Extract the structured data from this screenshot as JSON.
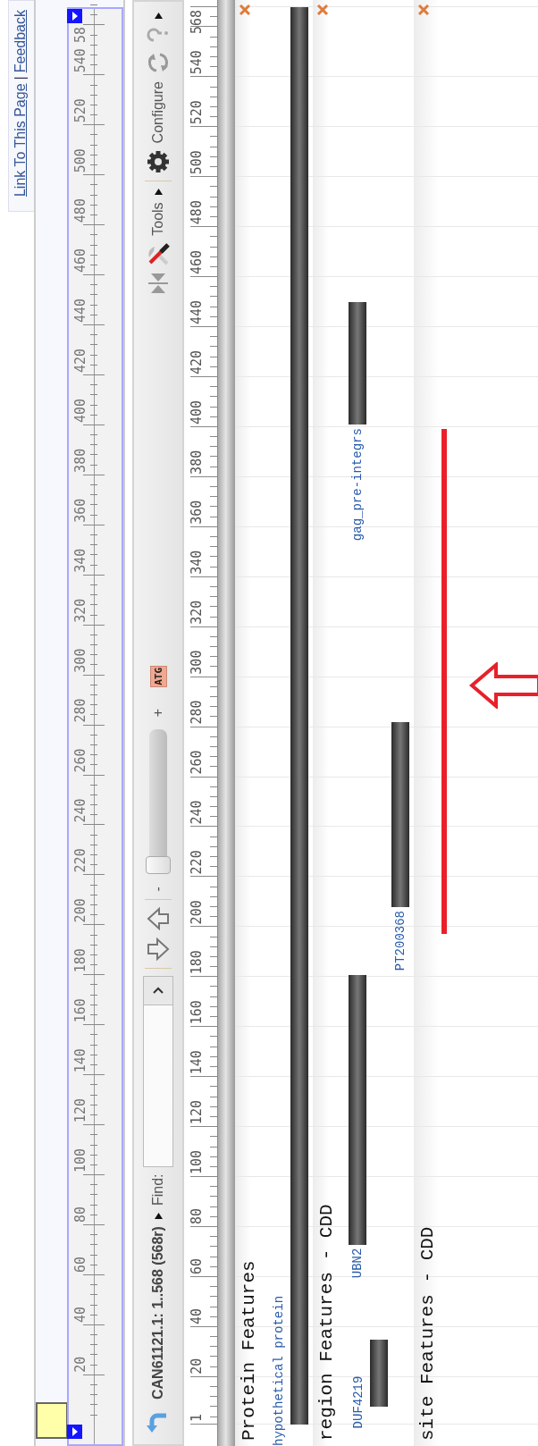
{
  "header": {
    "links": [
      {
        "label": "Link To This Page"
      },
      {
        "label": "Feedback"
      }
    ],
    "separator": "|"
  },
  "overview": {
    "ticks": [
      "20",
      "40",
      "60",
      "80",
      "100",
      "120",
      "140",
      "160",
      "180",
      "200",
      "220",
      "240",
      "260",
      "280",
      "300",
      "320",
      "340",
      "360",
      "380",
      "400",
      "420",
      "440",
      "460",
      "480",
      "500",
      "520",
      "540",
      "58"
    ]
  },
  "toolbar": {
    "sequence": "CAN61121.1: 1..568 (568r)",
    "find_label": "Find:",
    "zoom_out": "-",
    "zoom": {
      "level": 0
    },
    "zoom_in": "+",
    "sequence_button": "ATG",
    "tools": "Tools",
    "configure": "Configure"
  },
  "ruler": {
    "ticks": [
      "1",
      "20",
      "40",
      "60",
      "80",
      "100",
      "120",
      "140",
      "160",
      "180",
      "200",
      "220",
      "240",
      "260",
      "280",
      "300",
      "320",
      "340",
      "360",
      "380",
      "400",
      "420",
      "440",
      "460",
      "480",
      "500",
      "520",
      "540",
      "568"
    ]
  },
  "tracks": [
    {
      "title": "Protein Features",
      "lanes": [
        [
          {
            "label": "hypothetical protein"
          }
        ]
      ]
    },
    {
      "title": "region Features - CDD",
      "lanes": [
        [
          {
            "label": "UBN2"
          },
          {
            "label": "gag_pre-integrs"
          }
        ],
        [
          {
            "label": "DUF4219"
          }
        ],
        [
          {
            "label": "PT200368"
          }
        ]
      ]
    },
    {
      "title": "site Features - CDD"
    }
  ]
}
